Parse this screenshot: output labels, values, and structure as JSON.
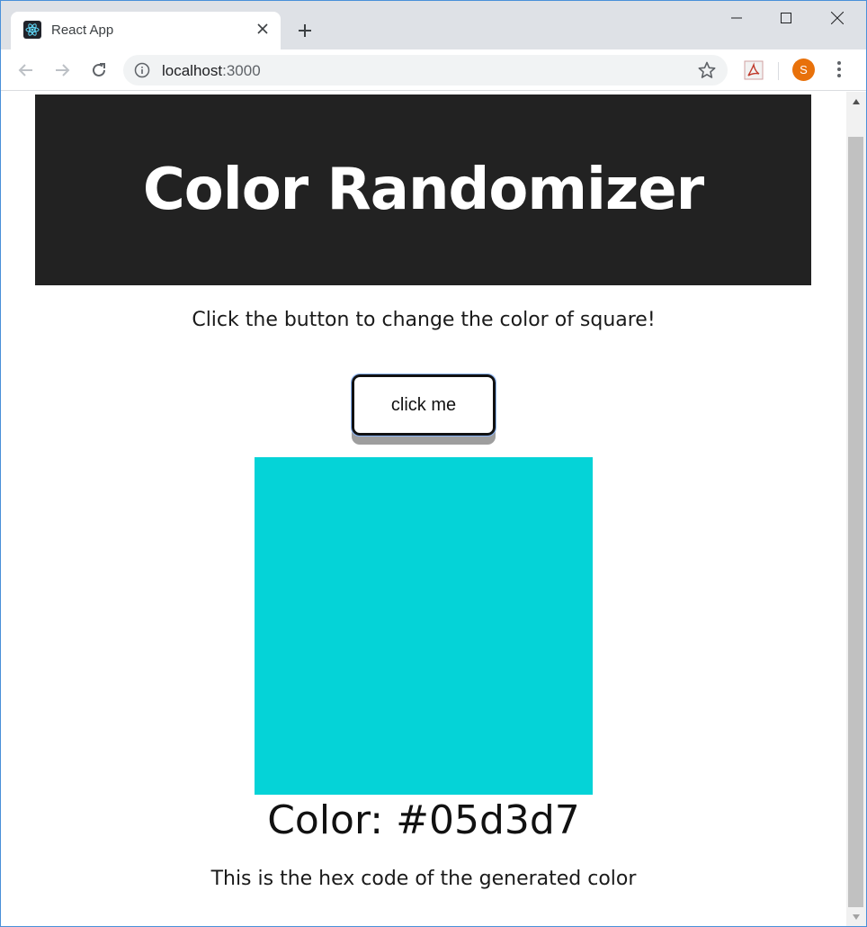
{
  "browser": {
    "tab_title": "React App",
    "url_host": "localhost",
    "url_port": ":3000",
    "avatar_letter": "S"
  },
  "page": {
    "title": "Color Randomizer",
    "instruction": "Click the button to change the color of square!",
    "button_label": "click me",
    "color_label": "Color: #05d3d7",
    "color_hex": "#05d3d7",
    "hex_note": "This is the hex code of the generated color"
  },
  "colors": {
    "header_bg": "#222222",
    "square": "#05d3d7",
    "avatar": "#e8710a"
  }
}
